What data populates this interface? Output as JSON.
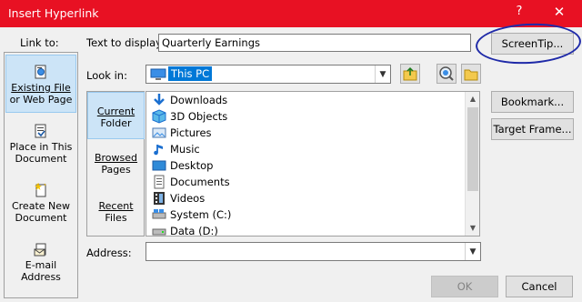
{
  "window": {
    "title": "Insert Hyperlink",
    "help_glyph": "?",
    "close_glyph": "✕"
  },
  "link_to": {
    "label": "Link to:",
    "items": [
      {
        "line1": "Existing File",
        "line2": "or Web Page",
        "icon": "existing-file-icon",
        "selected": true
      },
      {
        "line1": "Place in This",
        "line2": "Document",
        "icon": "place-in-document-icon",
        "selected": false
      },
      {
        "line1": "Create New",
        "line2": "Document",
        "icon": "create-new-document-icon",
        "selected": false
      },
      {
        "line1": "E-mail",
        "line2": "Address",
        "icon": "email-icon",
        "selected": false
      }
    ]
  },
  "text_to_display": {
    "label": "Text to display:",
    "value": "Quarterly Earnings"
  },
  "screentip_button": "ScreenTip...",
  "look_in": {
    "label": "Look in:",
    "value": "This PC"
  },
  "side_tabs": [
    {
      "line1": "Current",
      "line2": "Folder",
      "selected": true
    },
    {
      "line1": "Browsed",
      "line2": "Pages",
      "selected": false
    },
    {
      "line1": "Recent",
      "line2": "Files",
      "selected": false
    }
  ],
  "files": [
    {
      "name": "Downloads",
      "icon": "downloads-icon"
    },
    {
      "name": "3D Objects",
      "icon": "3d-objects-icon"
    },
    {
      "name": "Pictures",
      "icon": "pictures-icon"
    },
    {
      "name": "Music",
      "icon": "music-icon"
    },
    {
      "name": "Desktop",
      "icon": "desktop-icon"
    },
    {
      "name": "Documents",
      "icon": "documents-icon"
    },
    {
      "name": "Videos",
      "icon": "videos-icon"
    },
    {
      "name": "System (C:)",
      "icon": "system-drive-icon"
    },
    {
      "name": "Data (D:)",
      "icon": "data-drive-icon"
    }
  ],
  "right_buttons": {
    "bookmark": "Bookmark...",
    "target_frame": "Target Frame..."
  },
  "address": {
    "label": "Address:",
    "value": ""
  },
  "footer": {
    "ok": "OK",
    "cancel": "Cancel"
  },
  "colors": {
    "titlebar": "#e81123",
    "selection": "#cce4f7",
    "annotation_circle": "#1f2aa8"
  }
}
